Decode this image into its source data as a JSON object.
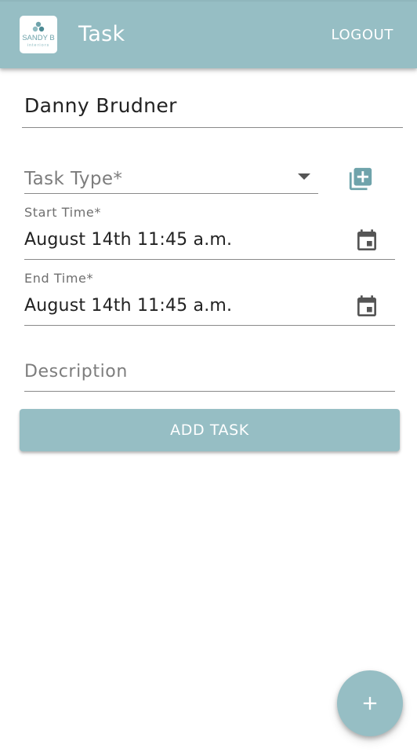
{
  "header": {
    "logo_text": "SANDY B",
    "logo_subtext": "interiors",
    "title": "Task",
    "logout_label": "LOGOUT"
  },
  "form": {
    "client_name": "Danny Brudner",
    "task_type_label": "Task Type*",
    "start_time_label": "Start Time*",
    "start_time_value": "August 14th 11:45 a.m.",
    "end_time_label": "End Time*",
    "end_time_value": "August 14th 11:45 a.m.",
    "description_placeholder": "Description",
    "submit_label": "ADD TASK"
  },
  "icons": {
    "add_type": "library-add-icon",
    "calendar": "calendar-icon",
    "fab": "plus-icon",
    "dropdown": "arrow-drop-down-icon"
  },
  "colors": {
    "primary": "#96bec4",
    "icon": "#555555",
    "accent_icon": "#6fa3ab"
  }
}
